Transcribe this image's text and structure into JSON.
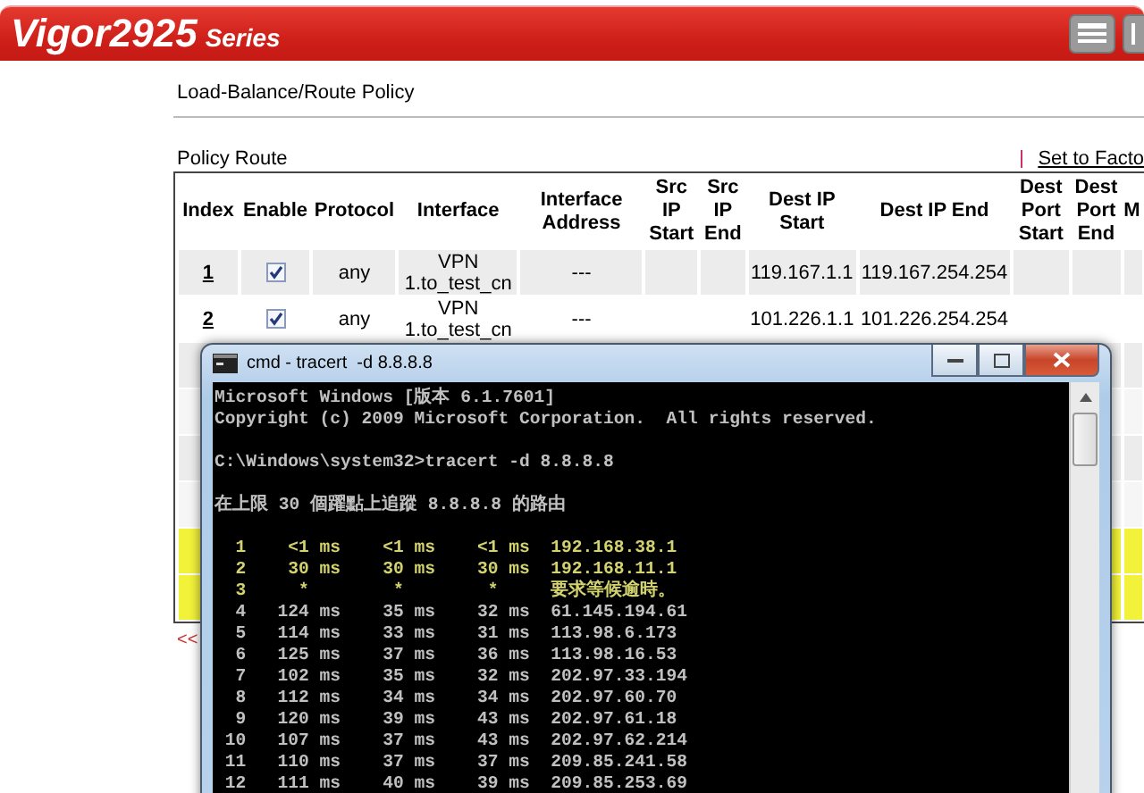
{
  "header": {
    "brand": "Vigor2925",
    "series": "Series"
  },
  "page_title": "Load-Balance/Route Policy",
  "section_title": "Policy Route",
  "factory_link": "Set to Facto",
  "table": {
    "columns": [
      "Index",
      "Enable",
      "Protocol",
      "Interface",
      "Interface Address",
      "Src IP Start",
      "Src IP End",
      "Dest IP Start",
      "Dest IP End",
      "Dest Port Start",
      "Dest Port End",
      "M"
    ],
    "rows": [
      {
        "index": "1",
        "enabled": true,
        "protocol": "any",
        "interface": "VPN 1.to_test_cn",
        "interface_address": "---",
        "dest_ip_start": "119.167.1.1",
        "dest_ip_end": "119.167.254.254",
        "highlighted": false
      },
      {
        "index": "2",
        "enabled": true,
        "protocol": "any",
        "interface": "VPN 1.to_test_cn",
        "interface_address": "---",
        "dest_ip_start": "101.226.1.1",
        "dest_ip_end": "101.226.254.254",
        "highlighted": false
      },
      {
        "highlighted": false
      },
      {
        "highlighted": false
      },
      {
        "highlighted": false
      },
      {
        "highlighted": false
      },
      {
        "highlighted": true
      },
      {
        "highlighted": true
      }
    ]
  },
  "pager": "<<",
  "console_window": {
    "title": "cmd - tracert  -d 8.8.8.8",
    "blocks": [
      {
        "lines": [
          {
            "text": "Microsoft Windows [版本 6.1.7601]",
            "color": "#c0c0c0"
          },
          {
            "text": "Copyright (c) 2009 Microsoft Corporation.  All rights reserved.",
            "color": "#c0c0c0"
          }
        ]
      },
      {
        "lines": [
          {
            "text": "C:\\Windows\\system32>tracert -d 8.8.8.8",
            "color": "#c0c0c0"
          }
        ]
      },
      {
        "lines": [
          {
            "text": "在上限 30 個躍點上追蹤 8.8.8.8 的路由",
            "color": "#c0c0c0"
          }
        ]
      },
      {
        "lines": [
          {
            "text": "  1    <1 ms    <1 ms    <1 ms  192.168.38.1",
            "color": "#d2d26e"
          },
          {
            "text": "  2    30 ms    30 ms    30 ms  192.168.11.1",
            "color": "#d2d26e"
          },
          {
            "text": "  3     *        *        *     要求等候逾時。",
            "color": "#d2d26e"
          },
          {
            "text": "  4   124 ms    35 ms    32 ms  61.145.194.61",
            "color": "#c0c0c0"
          },
          {
            "text": "  5   114 ms    33 ms    31 ms  113.98.6.173",
            "color": "#c0c0c0"
          },
          {
            "text": "  6   125 ms    37 ms    36 ms  113.98.16.53",
            "color": "#c0c0c0"
          },
          {
            "text": "  7   102 ms    35 ms    32 ms  202.97.33.194",
            "color": "#c0c0c0"
          },
          {
            "text": "  8   112 ms    34 ms    34 ms  202.97.60.70",
            "color": "#c0c0c0"
          },
          {
            "text": "  9   120 ms    39 ms    43 ms  202.97.61.18",
            "color": "#c0c0c0"
          },
          {
            "text": " 10   107 ms    37 ms    43 ms  202.97.62.214",
            "color": "#c0c0c0"
          },
          {
            "text": " 11   110 ms    37 ms    37 ms  209.85.241.58",
            "color": "#c0c0c0"
          },
          {
            "text": " 12   111 ms    40 ms    39 ms  209.85.253.69",
            "color": "#c0c0c0"
          }
        ]
      }
    ]
  }
}
